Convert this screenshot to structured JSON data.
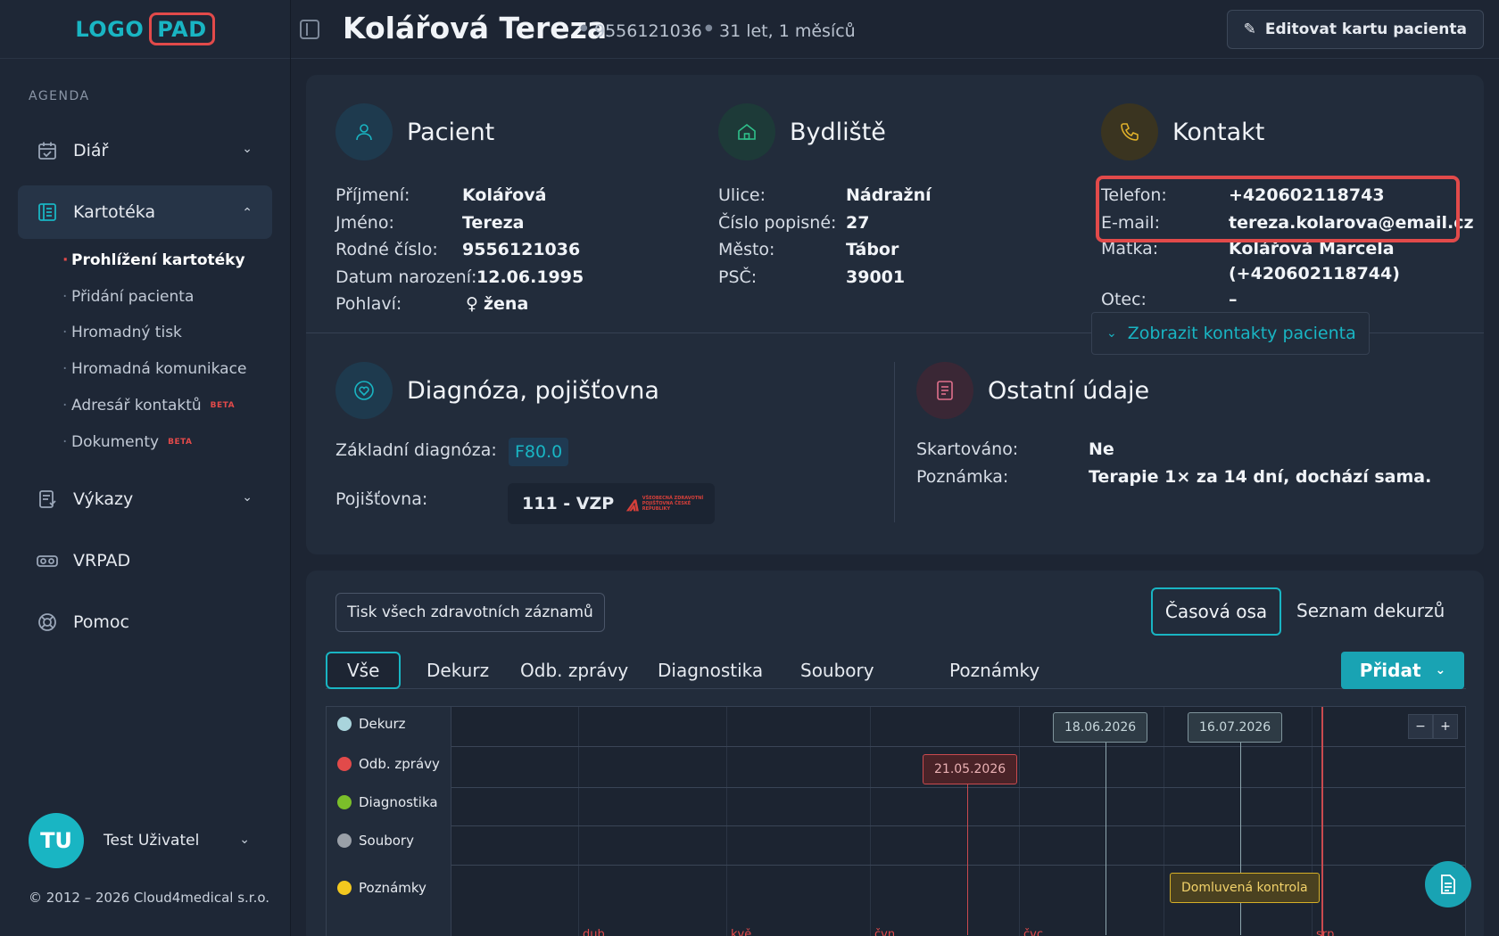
{
  "sidebar": {
    "logo_part1": "LOGO",
    "logo_part2": "PAD",
    "section_label": "AGENDA",
    "items": [
      {
        "label": "Diář"
      },
      {
        "label": "Kartotéka"
      },
      {
        "label": "Výkazy"
      },
      {
        "label": "VRPAD"
      },
      {
        "label": "Pomoc"
      }
    ],
    "sub_items": [
      {
        "label": "Prohlížení kartotéky"
      },
      {
        "label": "Přidání pacienta"
      },
      {
        "label": "Hromadný tisk"
      },
      {
        "label": "Hromadná komunikace"
      },
      {
        "label": "Adresář kontaktů",
        "badge": "BETA"
      },
      {
        "label": "Dokumenty",
        "badge": "BETA"
      }
    ],
    "user": {
      "initials": "TU",
      "name": "Test Uživatel"
    },
    "copyright": "© 2012 – 2026 Cloud4medical s.r.o."
  },
  "header": {
    "patient_name": "Kolářová Tereza",
    "birth_number": "9556121036",
    "age": "31 let, 1 měsíců",
    "edit_label": "Editovat kartu pacienta"
  },
  "patient": {
    "title": "Pacient",
    "fields": [
      {
        "label": "Příjmení:",
        "value": "Kolářová"
      },
      {
        "label": "Jméno:",
        "value": "Tereza"
      },
      {
        "label": "Rodné číslo:",
        "value": "9556121036"
      },
      {
        "label": "Datum narození:",
        "value": "12.06.1995"
      },
      {
        "label": "Pohlaví:",
        "value": "žena"
      }
    ]
  },
  "residence": {
    "title": "Bydliště",
    "fields": [
      {
        "label": "Ulice:",
        "value": "Nádražní"
      },
      {
        "label": "Číslo popisné:",
        "value": "27"
      },
      {
        "label": "Město:",
        "value": "Tábor"
      },
      {
        "label": "PSČ:",
        "value": "39001"
      }
    ]
  },
  "contact": {
    "title": "Kontakt",
    "fields": [
      {
        "label": "Telefon:",
        "value": "+420602118743"
      },
      {
        "label": "E-mail:",
        "value": "tereza.kolarova@email.cz"
      },
      {
        "label": "Matka:",
        "value": "Kolářová Marcela",
        "value2": "(+420602118744)"
      },
      {
        "label": "Otec:",
        "value": "–"
      }
    ],
    "show_contacts_label": "Zobrazit kontakty pacienta"
  },
  "diagnosis": {
    "title": "Diagnóza, pojišťovna",
    "diag_label": "Základní diagnóza:",
    "diag_code": "F80.0",
    "insurance_label": "Pojišťovna:",
    "insurance_value": "111 - VZP",
    "insurer_logo_text": "VŠEOBECNÁ ZDRAVOTNÍ POJIŠŤOVNA ČESKÉ REPUBLIKY"
  },
  "other": {
    "title": "Ostatní údaje",
    "shredded_label": "Skartováno:",
    "shredded_value": "Ne",
    "note_label": "Poznámka:",
    "note_value": "Terapie 1× za 14 dní, dochází sama."
  },
  "records": {
    "print_all_label": "Tisk všech zdravotních záznamů",
    "view_timeline_label": "Časová osa",
    "view_list_label": "Seznam dekurzů",
    "filters": [
      "Vše",
      "Dekurz",
      "Odb. zprávy",
      "Diagnostika",
      "Soubory",
      "Poznámky"
    ],
    "add_label": "Přidat"
  },
  "timeline": {
    "legend": [
      {
        "label": "Dekurz",
        "color": "#a9d4dc"
      },
      {
        "label": "Odb. zprávy",
        "color": "#e24a4a"
      },
      {
        "label": "Diagnostika",
        "color": "#7bbf2a"
      },
      {
        "label": "Soubory",
        "color": "#9aa0a8"
      },
      {
        "label": "Poznámky",
        "color": "#f2c81f"
      }
    ],
    "events": [
      {
        "label": "21.05.2026",
        "lane": "Odb. zprávy"
      },
      {
        "label": "18.06.2026",
        "lane": "Dekurz"
      },
      {
        "label": "16.07.2026",
        "lane": "Dekurz"
      },
      {
        "label": "Domluvená kontrola",
        "lane": "Poznámky"
      }
    ],
    "months": [
      "dub",
      "kvě",
      "čvn",
      "čvc",
      "srp"
    ],
    "zoom_out": "−",
    "zoom_in": "+"
  }
}
